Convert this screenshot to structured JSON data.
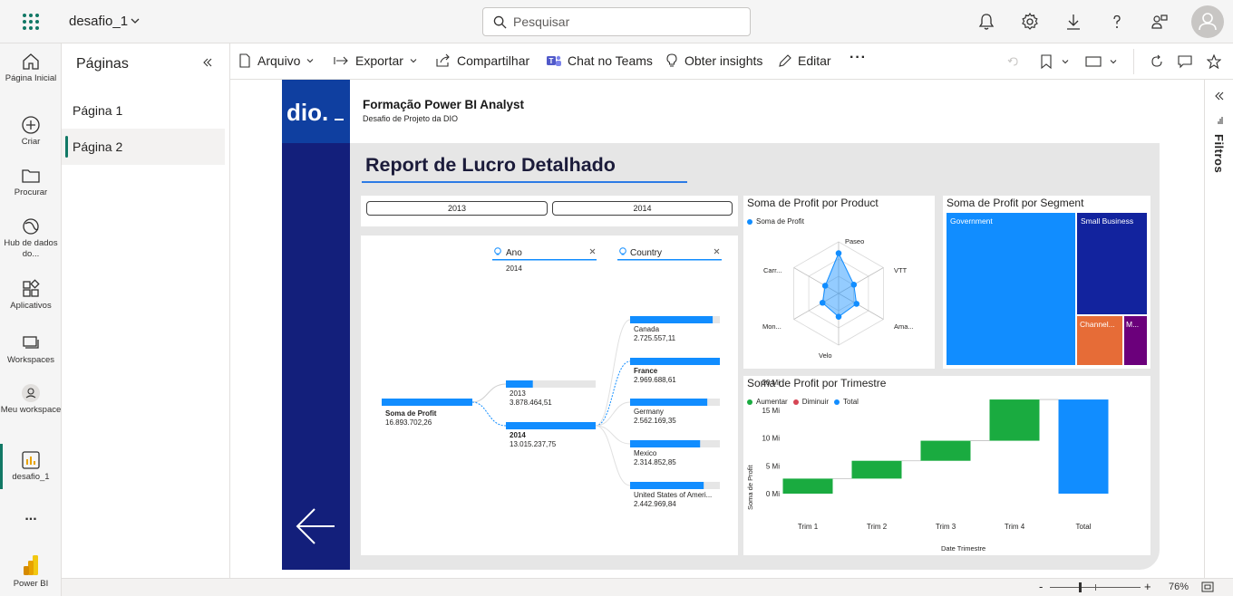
{
  "topbar": {
    "workspace_name": "desafio_1",
    "search_placeholder": "Pesquisar"
  },
  "leftnav": {
    "items": [
      {
        "label": "Página Inicial",
        "icon": "home-icon"
      },
      {
        "label": "Criar",
        "icon": "plus-circle-icon"
      },
      {
        "label": "Procurar",
        "icon": "folder-icon"
      },
      {
        "label": "Hub de dados do...",
        "icon": "data-hub-icon"
      },
      {
        "label": "Aplicativos",
        "icon": "apps-icon"
      },
      {
        "label": "Workspaces",
        "icon": "workspaces-icon"
      },
      {
        "label": "Meu workspace",
        "icon": "person-icon"
      },
      {
        "label": "desafio_1",
        "icon": "report-icon"
      }
    ],
    "more": "...",
    "powerbi_label": "Power BI"
  },
  "pages_panel": {
    "title": "Páginas",
    "pages": [
      "Página 1",
      "Página 2"
    ],
    "active_index": 1
  },
  "toolbar": {
    "arquivo": "Arquivo",
    "exportar": "Exportar",
    "compartilhar": "Compartilhar",
    "chat_teams": "Chat no Teams",
    "insights": "Obter insights",
    "editar": "Editar"
  },
  "filters_pane": {
    "label": "Filtros"
  },
  "status": {
    "zoom": "76%"
  },
  "report": {
    "header_title": "Formação Power BI Analyst",
    "header_subtitle": "Desafio de Projeto da DIO",
    "page_title": "Report de Lucro Detalhado",
    "slicer_years": [
      "2013",
      "2014"
    ],
    "colors": {
      "logo_bg": "#0f3fa0",
      "sidebar_bg": "#131f7b",
      "bar_blue": "#118dff",
      "increase": "#1aab40",
      "decrease": "#d64554",
      "total": "#118dff"
    },
    "decomposition": {
      "root": {
        "label": "Soma de Profit",
        "value": "16.893.702,26"
      },
      "level1_header": "Ano",
      "level1_selected": "2014",
      "level2_header": "Country",
      "years": [
        {
          "label": "2013",
          "value": "3.878.464,51",
          "fraction": 0.3
        },
        {
          "label": "2014",
          "value": "13.015.237,75",
          "fraction": 1.0
        }
      ],
      "countries": [
        {
          "label": "Canada",
          "value": "2.725.557,11",
          "fraction": 0.92
        },
        {
          "label": "France",
          "value": "2.969.688,61",
          "fraction": 1.0
        },
        {
          "label": "Germany",
          "value": "2.562.169,35",
          "fraction": 0.86
        },
        {
          "label": "Mexico",
          "value": "2.314.852,85",
          "fraction": 0.78
        },
        {
          "label": "United States of Ameri...",
          "value": "2.442.969,84",
          "fraction": 0.82
        }
      ]
    },
    "radar": {
      "title": "Soma de Profit por Product",
      "legend": "Soma de Profit",
      "axes": [
        "Paseo",
        "VTT",
        "Ama...",
        "Velo",
        "Mon...",
        "Carr..."
      ]
    },
    "treemap": {
      "title": "Soma de Profit por Segment",
      "segments": [
        {
          "label": "Government",
          "color": "#118dff"
        },
        {
          "label": "Small Business",
          "color": "#12239e"
        },
        {
          "label": "Channel...",
          "color": "#e66c37"
        },
        {
          "label": "M...",
          "color": "#6b007b"
        }
      ]
    }
  },
  "chart_data": {
    "type": "bar",
    "title": "Soma de Profit por Trimestre",
    "categories": [
      "Trim 1",
      "Trim 2",
      "Trim 3",
      "Trim 4",
      "Total"
    ],
    "series": [
      {
        "name": "Aumentar",
        "values": [
          2.7,
          3.2,
          3.6,
          7.4,
          null
        ]
      },
      {
        "name": "Diminuir",
        "values": [
          null,
          null,
          null,
          null,
          null
        ]
      },
      {
        "name": "Total",
        "values": [
          null,
          null,
          null,
          null,
          16.9
        ]
      }
    ],
    "waterfall_start": [
      0,
      2.7,
      5.9,
      9.5,
      0
    ],
    "yticks": [
      "0 Mi",
      "5 Mi",
      "10 Mi",
      "15 Mi",
      "20 Mi"
    ],
    "ylim": [
      0,
      20
    ],
    "ylabel": "Soma de Profit",
    "xlabel": "Date Trimestre",
    "legend_position": "top-left"
  }
}
